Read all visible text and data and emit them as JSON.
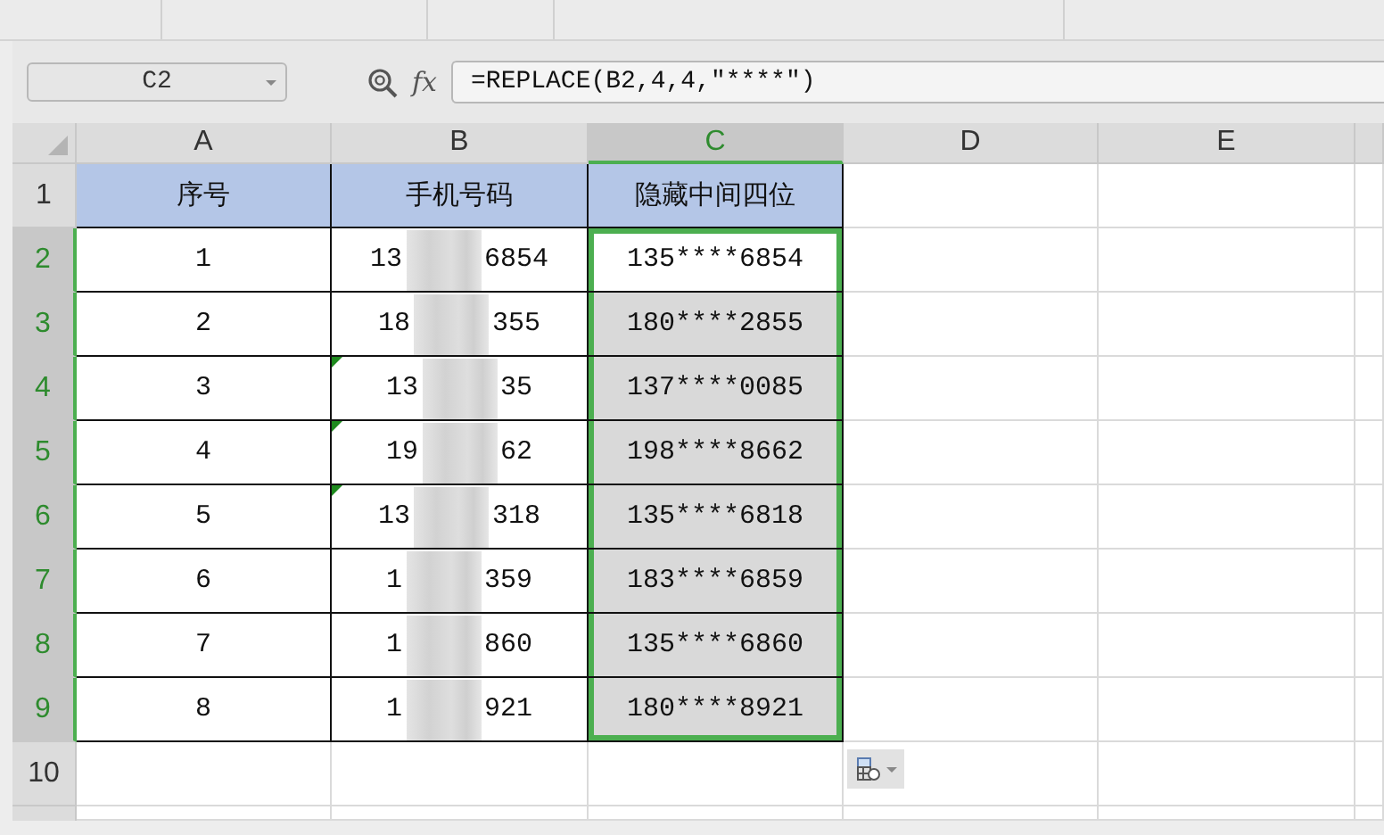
{
  "name_box": {
    "value": "C2"
  },
  "formula_bar": {
    "function_label": "fx",
    "value": "=REPLACE(B2,4,4,\"****\")"
  },
  "columns": [
    {
      "label": "A",
      "selected": false
    },
    {
      "label": "B",
      "selected": false
    },
    {
      "label": "C",
      "selected": true
    },
    {
      "label": "D",
      "selected": false
    },
    {
      "label": "E",
      "selected": false
    }
  ],
  "header_row": {
    "label": "1",
    "selected": false,
    "cells": [
      "序号",
      "手机号码",
      "隐藏中间四位"
    ]
  },
  "rows": [
    {
      "label": "2",
      "selected": true,
      "number": "1",
      "phone": {
        "start": "13",
        "end": "6854",
        "flagged": false
      },
      "masked": {
        "text": "135****6854",
        "active": true
      }
    },
    {
      "label": "3",
      "selected": true,
      "number": "2",
      "phone": {
        "start": "18",
        "end": "355",
        "flagged": false
      },
      "masked": {
        "text": "180****2855",
        "active": false
      }
    },
    {
      "label": "4",
      "selected": true,
      "number": "3",
      "phone": {
        "start": "13",
        "end": "35",
        "flagged": true
      },
      "masked": {
        "text": "137****0085",
        "active": false
      }
    },
    {
      "label": "5",
      "selected": true,
      "number": "4",
      "phone": {
        "start": "19",
        "end": "62",
        "flagged": true
      },
      "masked": {
        "text": "198****8662",
        "active": false
      }
    },
    {
      "label": "6",
      "selected": true,
      "number": "5",
      "phone": {
        "start": "13",
        "end": "318",
        "flagged": true
      },
      "masked": {
        "text": "135****6818",
        "active": false
      }
    },
    {
      "label": "7",
      "selected": true,
      "number": "6",
      "phone": {
        "start": "1",
        "end": "359",
        "flagged": false
      },
      "masked": {
        "text": "183****6859",
        "active": false
      }
    },
    {
      "label": "8",
      "selected": true,
      "number": "7",
      "phone": {
        "start": "1",
        "end": "860",
        "flagged": false
      },
      "masked": {
        "text": "135****6860",
        "active": false
      }
    },
    {
      "label": "9",
      "selected": true,
      "number": "8",
      "phone": {
        "start": "1",
        "end": "921",
        "flagged": false
      },
      "masked": {
        "text": "180****8921",
        "active": false
      }
    }
  ],
  "empty_rows": [
    {
      "label": "10",
      "selected": false
    }
  ]
}
